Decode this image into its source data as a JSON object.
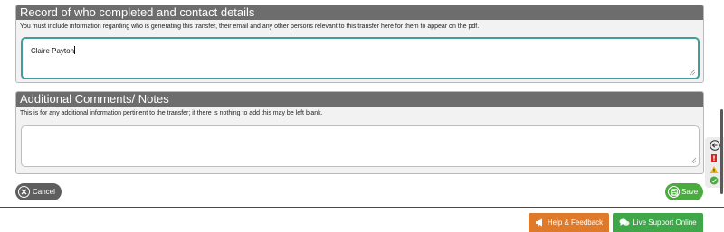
{
  "contact_section": {
    "title": "Record of who completed and contact details",
    "description": "You must include information regarding who is generating this transfer, their email and any other persons relevant to this transfer here for them to appear on the pdf.",
    "value": "Claire Payton"
  },
  "comments_section": {
    "title": "Additional Comments/ Notes",
    "description": "This is for any additional information pertinent to the transfer; if there is nothing to add this may be left blank.",
    "value": ""
  },
  "actions": {
    "cancel_label": "Cancel",
    "save_label": "Save"
  },
  "footer": {
    "help_label": "Help & Feedback",
    "live_support_label": "Live Support Online"
  },
  "colors": {
    "header": "#6d6d6d",
    "focus_border": "#3f9f9e",
    "save": "#4aab3e",
    "cancel": "#5e5e5e",
    "help": "#e07a2b",
    "live_support": "#3fa64a"
  },
  "icons": {
    "cancel": "x-circle-icon",
    "save": "floppy-disk-icon",
    "help": "megaphone-icon",
    "live_support": "chat-bubbles-icon",
    "side_tools": [
      "arrow-left-circle-icon",
      "red-flag-icon",
      "warning-triangle-icon",
      "green-check-icon"
    ]
  }
}
